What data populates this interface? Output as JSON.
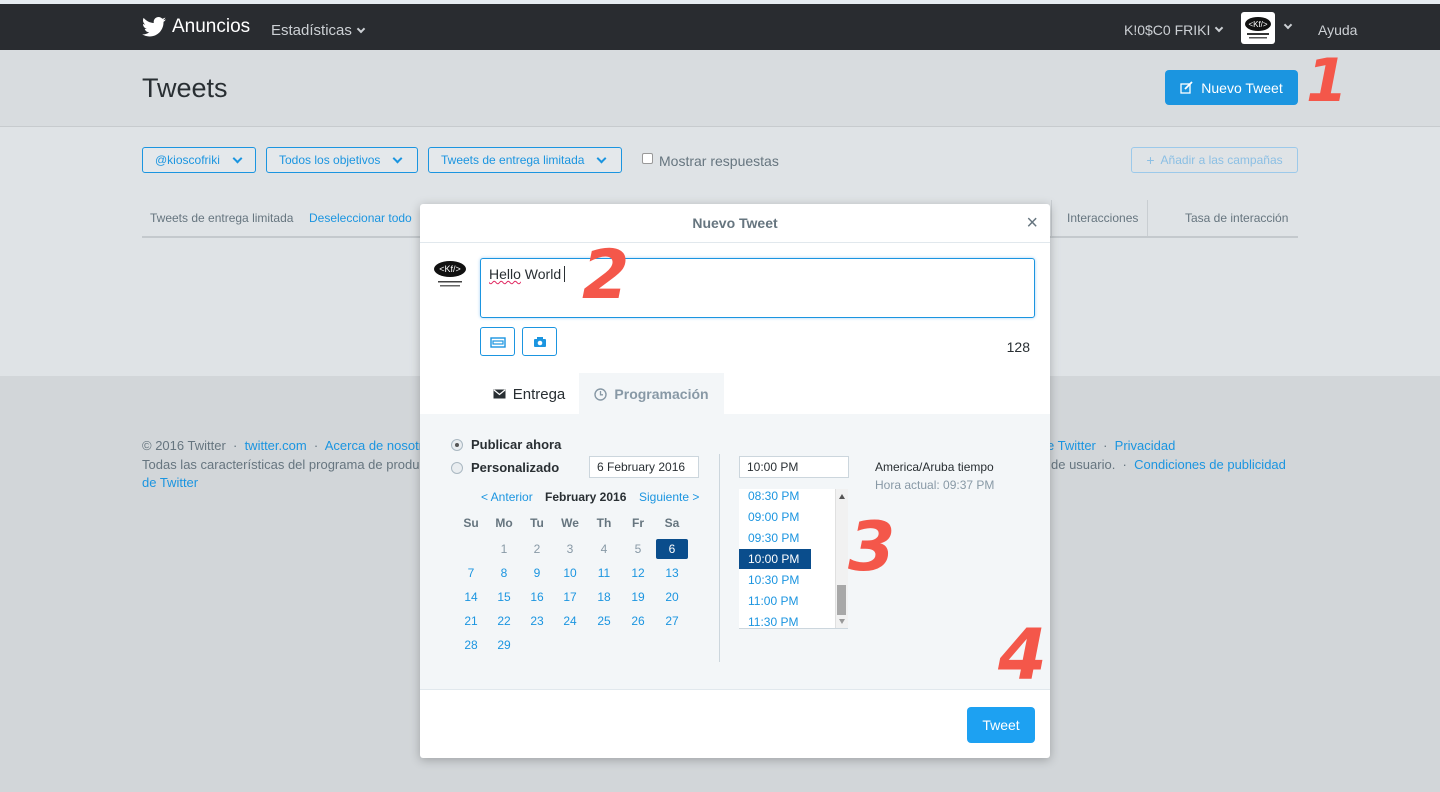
{
  "topnav": {
    "brand": "Anuncios",
    "stats": "Estadísticas",
    "account": "K!0$C0 FRIKI",
    "help": "Ayuda"
  },
  "header": {
    "title": "Tweets",
    "new_tweet": "Nuevo Tweet"
  },
  "filters": {
    "account": "@kioscofriki",
    "objectives": "Todos los objetivos",
    "delivery": "Tweets de entrega limitada",
    "show_replies": "Mostrar respuestas",
    "add_campaigns": "Añadir a las campañas"
  },
  "table": {
    "label": "Tweets de entrega limitada",
    "deselect": "Deseleccionar todo",
    "col_interactions": "Interacciones",
    "col_rate": "Tasa de interacción"
  },
  "footer": {
    "copyright": "© 2016 Twitter",
    "link1": "twitter.com",
    "link2": "Acerca de nosotr",
    "link3": "e Twitter",
    "link4": "Privacidad",
    "line2_left": "Todas las características del programa de produ",
    "line2_right": "de usuario.",
    "link5": "Condiciones de publicidad",
    "link5b": "de Twitter"
  },
  "modal": {
    "title": "Nuevo Tweet",
    "compose_text_a": "Hello",
    "compose_text_b": " World",
    "char_count": "128",
    "tab_delivery": "Entrega",
    "tab_schedule": "Programación",
    "publish_now": "Publicar ahora",
    "custom": "Personalizado",
    "date_value": "6 February 2016",
    "time_value": "10:00 PM",
    "prev": "< Anterior",
    "next": "Siguiente >",
    "month": "February 2016",
    "timezone": "America/Aruba tiempo",
    "current_time": "Hora actual: 09:37 PM",
    "tweet_button": "Tweet"
  },
  "calendar": {
    "dow": [
      "Su",
      "Mo",
      "Tu",
      "We",
      "Th",
      "Fr",
      "Sa"
    ],
    "weeks": [
      [
        "",
        "1",
        "2",
        "3",
        "4",
        "5",
        "6"
      ],
      [
        "7",
        "8",
        "9",
        "10",
        "11",
        "12",
        "13"
      ],
      [
        "14",
        "15",
        "16",
        "17",
        "18",
        "19",
        "20"
      ],
      [
        "21",
        "22",
        "23",
        "24",
        "25",
        "26",
        "27"
      ],
      [
        "28",
        "29",
        "",
        "",
        "",
        "",
        ""
      ]
    ],
    "selected": "6",
    "muted": [
      "1",
      "2",
      "3",
      "4",
      "5"
    ]
  },
  "time_slots": [
    "08:30 PM",
    "09:00 PM",
    "09:30 PM",
    "10:00 PM",
    "10:30 PM",
    "11:00 PM",
    "11:30 PM"
  ],
  "time_selected": "10:00 PM",
  "annotations": [
    "1",
    "2",
    "3",
    "4"
  ],
  "colors": {
    "accent": "#1b95e0",
    "annotation": "#f4574a",
    "selected": "#0a4d8c"
  }
}
